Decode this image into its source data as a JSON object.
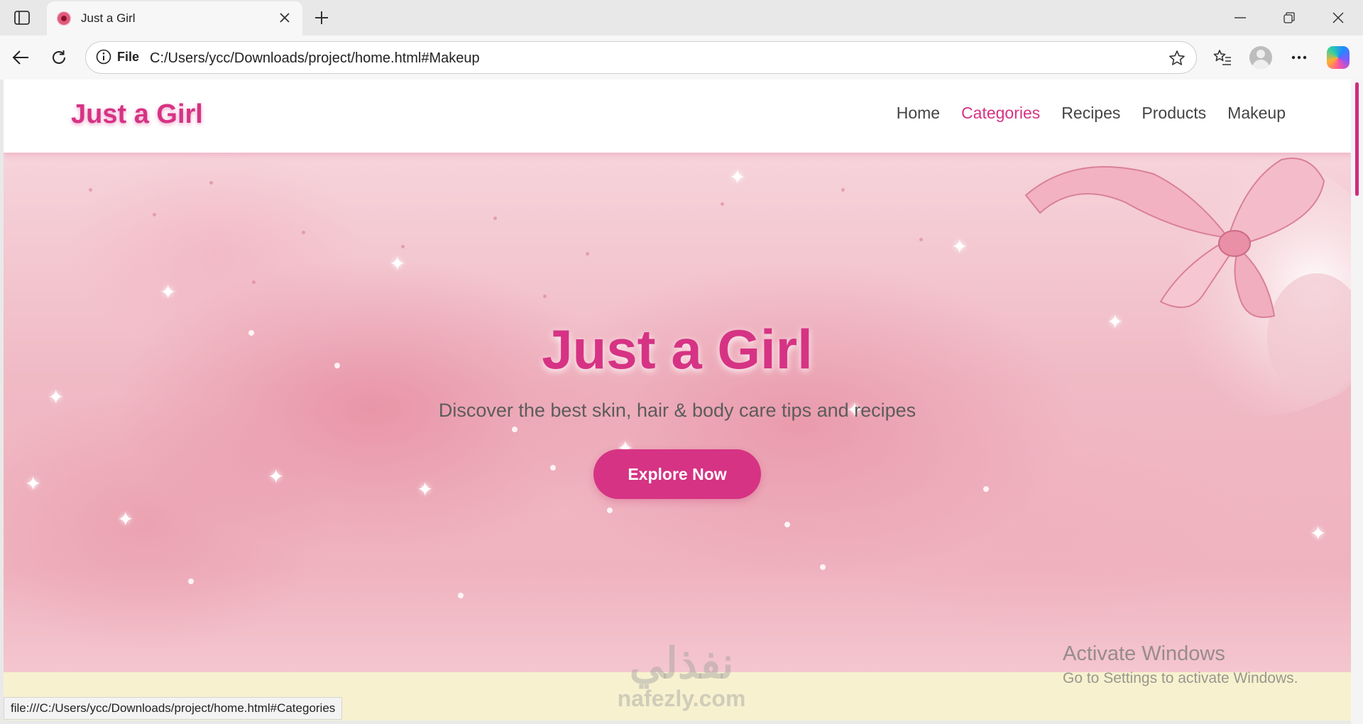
{
  "browser": {
    "tab_title": "Just a Girl",
    "site_info_label": "File",
    "url": "C:/Users/ycc/Downloads/project/home.html#Makeup",
    "status_url": "file:///C:/Users/ycc/Downloads/project/home.html#Categories"
  },
  "site": {
    "logo": "Just a Girl",
    "nav": [
      {
        "label": "Home",
        "active": false
      },
      {
        "label": "Categories",
        "active": true
      },
      {
        "label": "Recipes",
        "active": false
      },
      {
        "label": "Products",
        "active": false
      },
      {
        "label": "Makeup",
        "active": false
      }
    ]
  },
  "hero": {
    "title": "Just a Girl",
    "subtitle": "Discover the best skin, hair & body care tips and recipes",
    "cta_label": "Explore Now"
  },
  "overlays": {
    "watermark_arabic": "نفذلي",
    "watermark_latin": "nafezly.com",
    "activate_title": "Activate Windows",
    "activate_subtitle": "Go to Settings to activate Windows."
  },
  "colors": {
    "brand_pink": "#d63384",
    "hero_background": "#f0b9c4",
    "next_section": "#f7f1cf"
  },
  "icons": [
    "tab-list-icon",
    "favicon-icon",
    "close-tab-icon",
    "new-tab-icon",
    "minimize-icon",
    "restore-icon",
    "close-window-icon",
    "back-icon",
    "reload-icon",
    "info-icon",
    "star-icon",
    "favorites-icon",
    "profile-icon",
    "more-icon",
    "copilot-icon",
    "bow-icon",
    "sparkle-icon"
  ]
}
